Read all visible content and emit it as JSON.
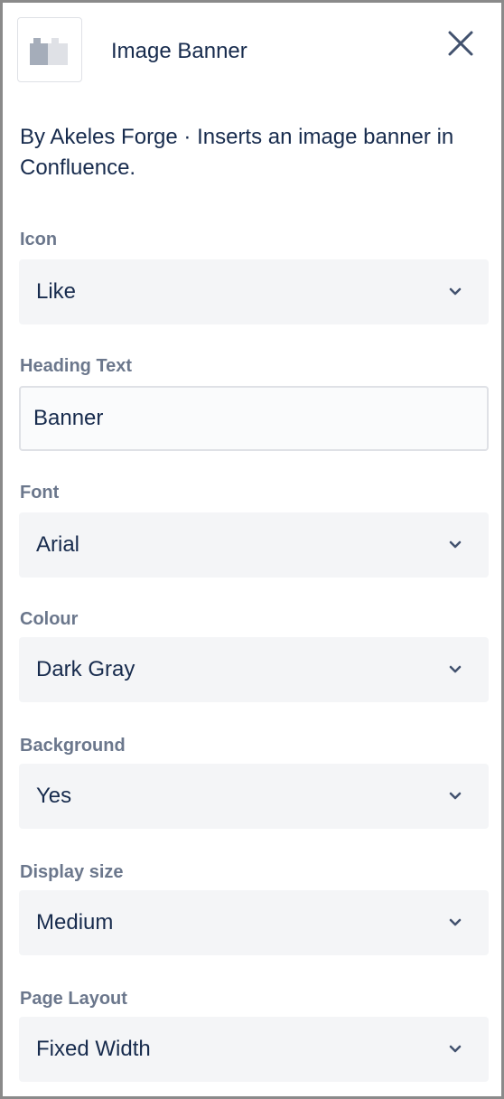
{
  "header": {
    "app_title": "Image Banner",
    "logo_icon": "app-logo-blocks-icon",
    "close_icon": "close-icon"
  },
  "description": "By Akeles Forge · Inserts an image banner in Confluence.",
  "fields": {
    "icon": {
      "label": "Icon",
      "value": "Like"
    },
    "heading_text": {
      "label": "Heading Text",
      "value": "Banner"
    },
    "font": {
      "label": "Font",
      "value": "Arial"
    },
    "colour": {
      "label": "Colour",
      "value": "Dark Gray"
    },
    "background": {
      "label": "Background",
      "value": "Yes"
    },
    "display_size": {
      "label": "Display size",
      "value": "Medium"
    },
    "page_layout": {
      "label": "Page Layout",
      "value": "Fixed Width"
    }
  },
  "colors": {
    "text_primary": "#172b4d",
    "label_gray": "#6b778c",
    "field_background": "#f4f5f7",
    "border": "#dfe1e6"
  }
}
